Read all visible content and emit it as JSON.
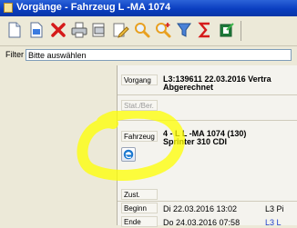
{
  "window": {
    "title": "Vorgänge - Fahrzeug L  -MA 1074"
  },
  "toolbar": {
    "icons": [
      "new-document-icon",
      "open-document-icon",
      "delete-icon",
      "print-icon",
      "print-preview-icon",
      "edit-icon",
      "search-icon",
      "search-plus-icon",
      "filter-icon",
      "sum-icon",
      "export-icon"
    ]
  },
  "filter": {
    "label": "Filter",
    "value": "Bitte auswählen"
  },
  "details": {
    "vorgang_label": "Vorgang",
    "vorgang_line1": "L3:139611 22.03.2016 Vertra",
    "vorgang_line2": "Abgerechnet",
    "statber_label": "Stat./Ber.",
    "fahrzeug_label": "Fahrzeug",
    "fahrzeug_line1": "4 - L  L  -MA 1074 (130)",
    "fahrzeug_line2": "Sprinter 310 CDI",
    "zust_label": "Zust.",
    "beginn_label": "Beginn",
    "beginn_value": "Di  22.03.2016 13:02",
    "beginn_extra": "L3 Pi",
    "ende_label": "Ende",
    "ende_value": "Do  24.03.2016 07:58",
    "ende_extra": "L3 L"
  },
  "colors": {
    "titlebar": "#0a3ec0",
    "highlight": "#ffff00",
    "link": "#1d3ec9"
  }
}
